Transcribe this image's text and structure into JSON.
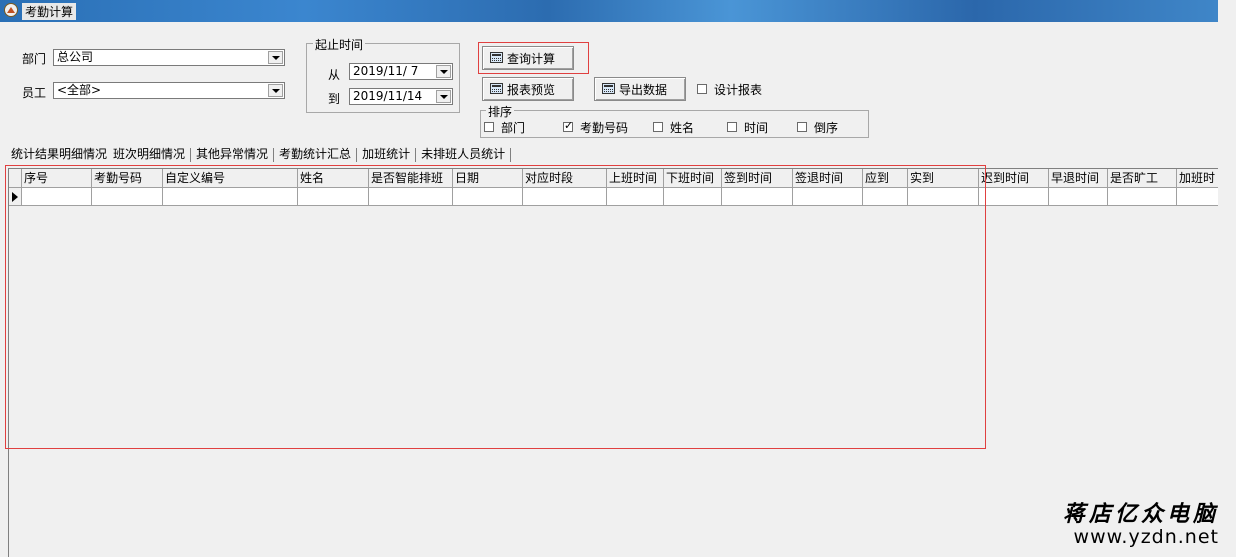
{
  "window": {
    "title": "考勤计算"
  },
  "filters": {
    "dept_label": "部门",
    "dept_value": "总公司",
    "employee_label": "员工",
    "employee_value": "<全部>"
  },
  "date_range": {
    "group_title": "起止时间",
    "from_label": "从",
    "from_value": "2019/11/ 7",
    "to_label": "到",
    "to_value": "2019/11/14"
  },
  "actions": {
    "query_label": "查询计算",
    "preview_label": "报表预览",
    "export_label": "导出数据",
    "design_report_label": "设计报表",
    "design_report_checked": false
  },
  "sort": {
    "group_title": "排序",
    "options": [
      {
        "label": "部门",
        "checked": false
      },
      {
        "label": "考勤号码",
        "checked": true
      },
      {
        "label": "姓名",
        "checked": false
      },
      {
        "label": "时间",
        "checked": false
      },
      {
        "label": "倒序",
        "checked": false
      }
    ]
  },
  "tabs": [
    {
      "label": "统计结果明细情况",
      "active": false
    },
    {
      "label": "班次明细情况",
      "active": true
    },
    {
      "label": "其他异常情况",
      "active": false
    },
    {
      "label": "考勤统计汇总",
      "active": false
    },
    {
      "label": "加班统计",
      "active": false
    },
    {
      "label": "未排班人员统计",
      "active": false
    }
  ],
  "grid": {
    "columns": [
      "序号",
      "考勤号码",
      "自定义编号",
      "姓名",
      "是否智能排班",
      "日期",
      "对应时段",
      "上班时间",
      "下班时间",
      "签到时间",
      "签退时间",
      "应到",
      "实到",
      "迟到时间",
      "早退时间",
      "是否旷工",
      "加班时"
    ]
  },
  "watermark": {
    "line1": "蒋店亿众电脑",
    "line2": "www.yzdn.net"
  }
}
